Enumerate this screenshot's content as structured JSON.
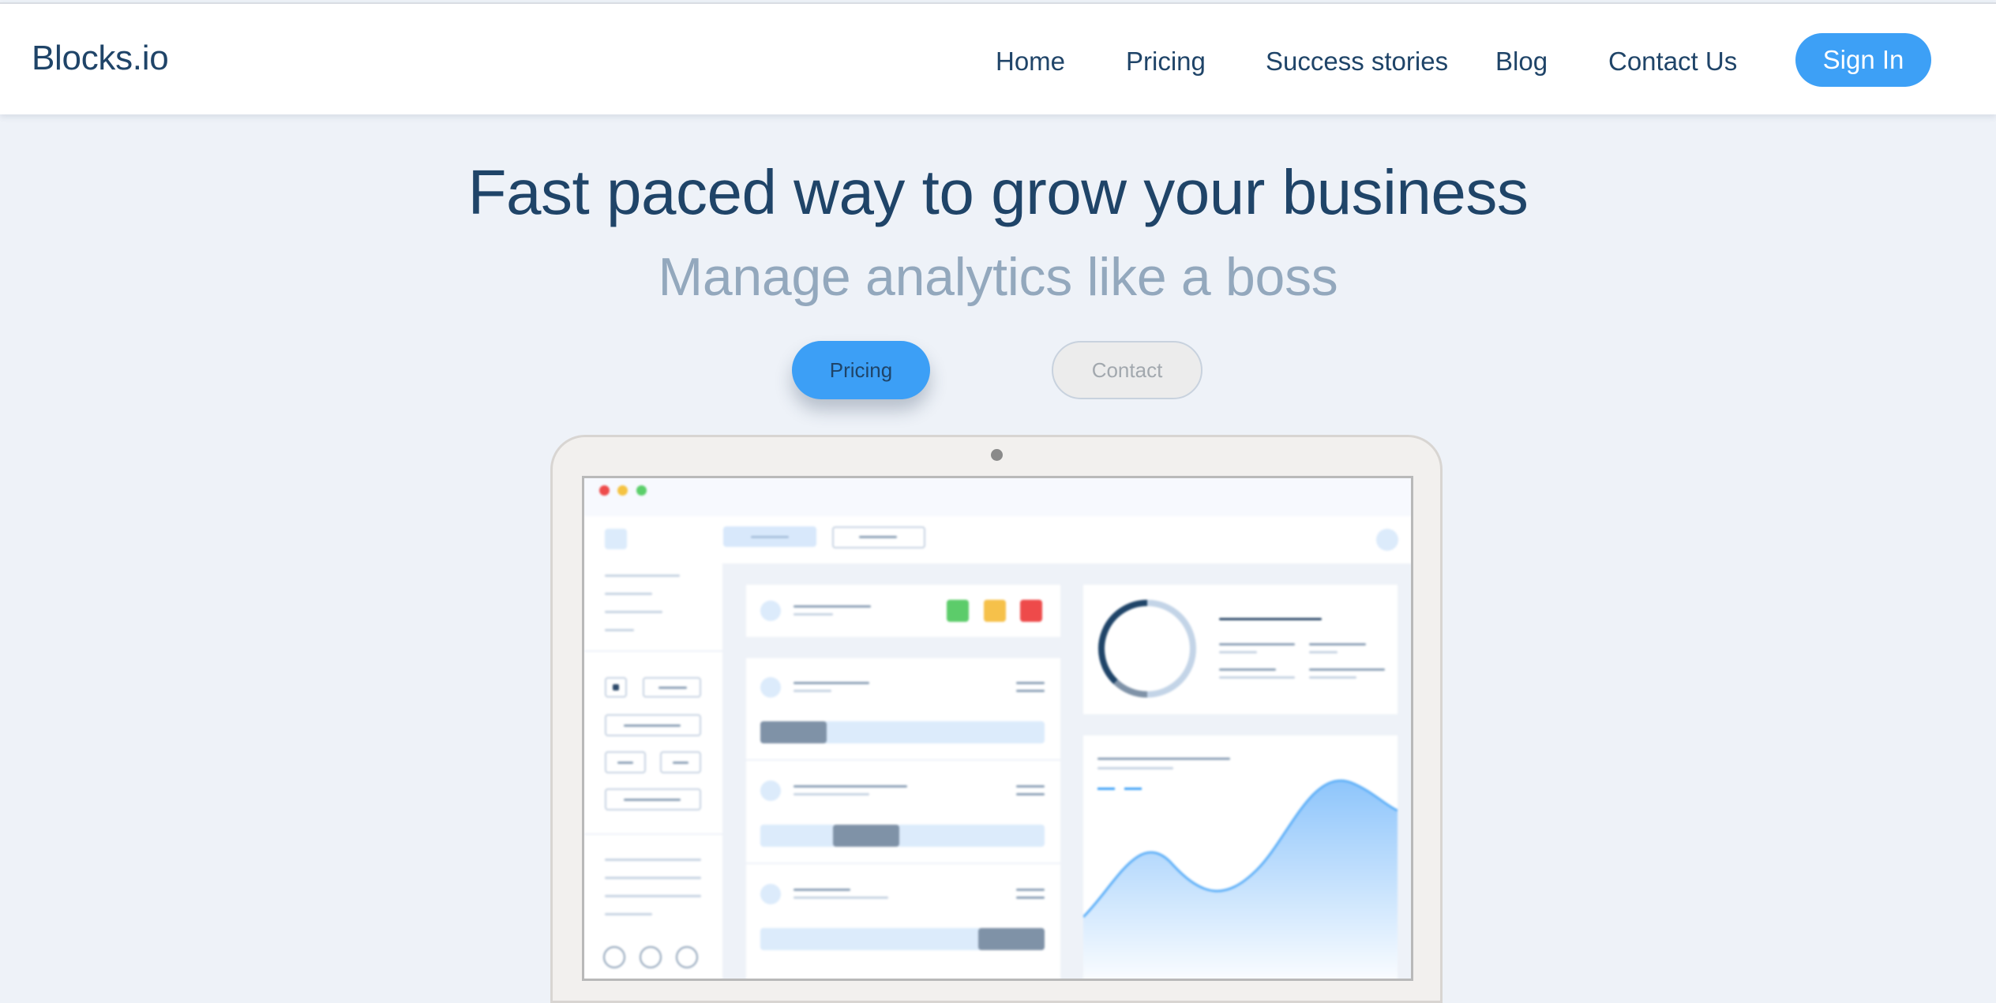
{
  "nav": {
    "brand": "Blocks.io",
    "links": [
      "Home",
      "Pricing",
      "Success stories",
      "Blog",
      "Contact Us"
    ],
    "signin": "Sign In"
  },
  "hero": {
    "title": "Fast paced way to grow your business",
    "subtitle": "Manage analytics like a boss",
    "primary_button": "Pricing",
    "secondary_button": "Contact"
  },
  "colors": {
    "accent": "#3da0f6",
    "heading": "#1f4468",
    "subtitle": "#93a8bd",
    "background": "#eef2f8"
  },
  "mockup": {
    "window_dots": [
      "#ee4b4b",
      "#f5c342",
      "#5bcf6a"
    ],
    "status_chips": [
      "#5ccc6a",
      "#f6c14a",
      "#ee4a4a"
    ]
  }
}
